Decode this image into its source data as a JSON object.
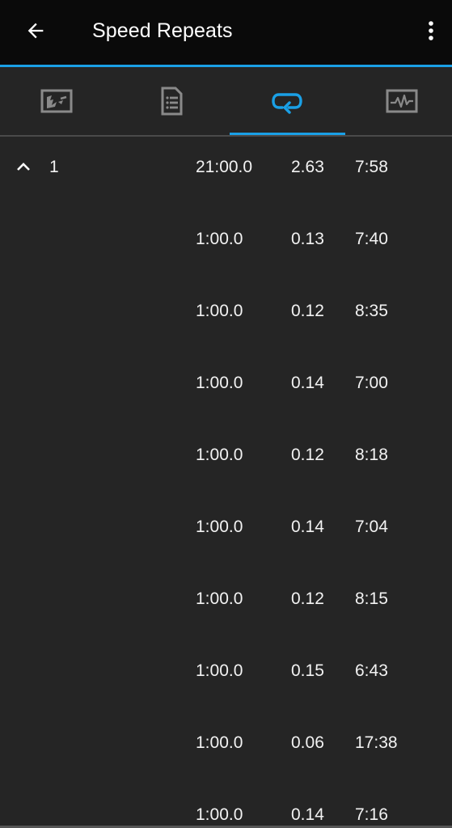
{
  "header": {
    "title": "Speed Repeats",
    "back_icon": "arrow-left-icon",
    "menu_icon": "more-vert-icon"
  },
  "tabs": [
    {
      "icon": "chart-map-icon",
      "active": false
    },
    {
      "icon": "document-list-icon",
      "active": false
    },
    {
      "icon": "laps-loop-icon",
      "active": true
    },
    {
      "icon": "activity-graph-icon",
      "active": false
    }
  ],
  "colors": {
    "accent": "#1aa0e6",
    "appbar_bg": "#0a0a0a",
    "content_bg": "#252525",
    "inactive_icon": "#8a8a8a"
  },
  "lap_group": {
    "number": "1",
    "expanded": true,
    "time": "21:00.0",
    "distance": "2.63",
    "pace": "7:58"
  },
  "laps": [
    {
      "time": "1:00.0",
      "distance": "0.13",
      "pace": "7:40"
    },
    {
      "time": "1:00.0",
      "distance": "0.12",
      "pace": "8:35"
    },
    {
      "time": "1:00.0",
      "distance": "0.14",
      "pace": "7:00"
    },
    {
      "time": "1:00.0",
      "distance": "0.12",
      "pace": "8:18"
    },
    {
      "time": "1:00.0",
      "distance": "0.14",
      "pace": "7:04"
    },
    {
      "time": "1:00.0",
      "distance": "0.12",
      "pace": "8:15"
    },
    {
      "time": "1:00.0",
      "distance": "0.15",
      "pace": "6:43"
    },
    {
      "time": "1:00.0",
      "distance": "0.06",
      "pace": "17:38"
    },
    {
      "time": "1:00.0",
      "distance": "0.14",
      "pace": "7:16"
    }
  ]
}
